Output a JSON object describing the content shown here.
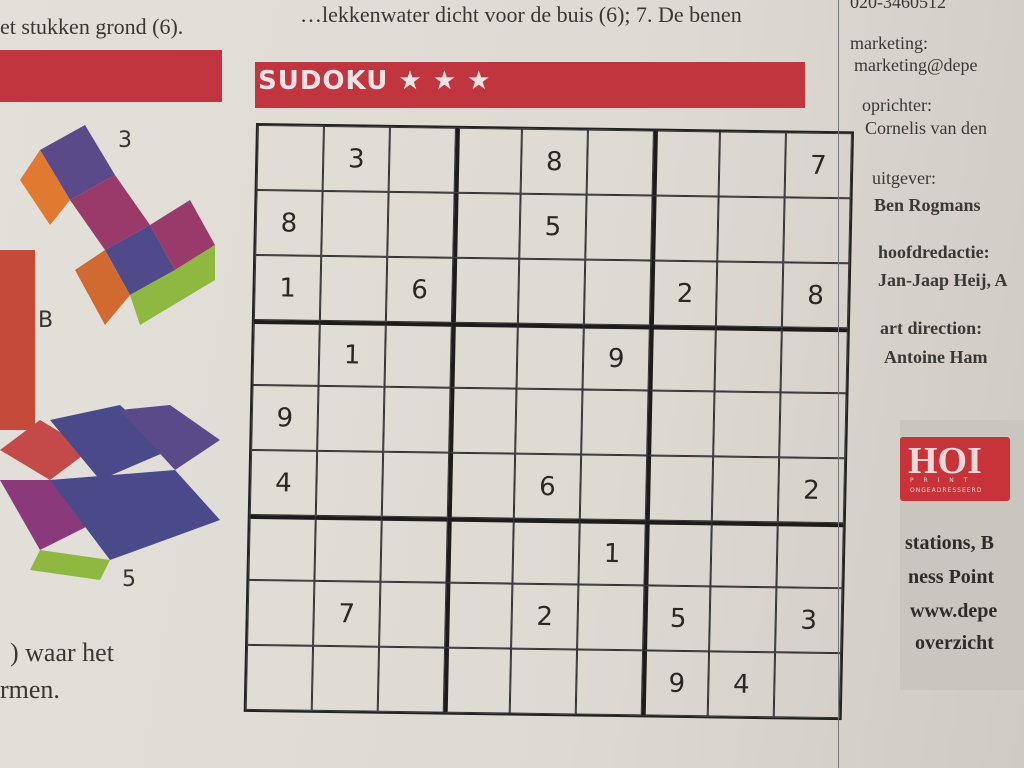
{
  "article": {
    "top_line": "…lekkenwater dicht voor de buis (6); 7. De benen",
    "second_line": "et stukken grond (6).",
    "bottom_line_1": ") waar het",
    "bottom_line_2": "rmen."
  },
  "figure": {
    "labels": [
      "3",
      "B",
      "5"
    ]
  },
  "sudoku": {
    "title": "SUDOKU ★ ★ ★",
    "difficulty_stars": 3,
    "grid": [
      [
        "",
        "3",
        "",
        "",
        "8",
        "",
        "",
        "",
        "7"
      ],
      [
        "8",
        "",
        "",
        "",
        "5",
        "",
        "",
        "",
        ""
      ],
      [
        "1",
        "",
        "6",
        "",
        "",
        "",
        "2",
        "",
        "8"
      ],
      [
        "",
        "1",
        "",
        "",
        "",
        "9",
        "",
        "",
        ""
      ],
      [
        "9",
        "",
        "",
        "",
        "",
        "",
        "",
        "",
        ""
      ],
      [
        "4",
        "",
        "",
        "",
        "6",
        "",
        "",
        "",
        "2"
      ],
      [
        "",
        "",
        "",
        "",
        "",
        "1",
        "",
        "",
        ""
      ],
      [
        "",
        "7",
        "",
        "",
        "2",
        "",
        "5",
        "",
        "3"
      ],
      [
        "",
        "",
        "",
        "",
        "",
        "",
        "9",
        "4",
        ""
      ]
    ]
  },
  "colophon": {
    "phone": "020-3460512",
    "entries": [
      {
        "label": "marketing:",
        "value": "marketing@depe"
      },
      {
        "label": "oprichter:",
        "value": "Cornelis van den"
      },
      {
        "label": "uitgever:",
        "value": "Ben Rogmans"
      },
      {
        "label": "hoofdredactie:",
        "value": "Jan-Jaap Heij, A"
      },
      {
        "label": "art direction:",
        "value": "Antoine Ham"
      }
    ],
    "logo": {
      "main": "HOI",
      "sub1": "P R I N T",
      "sub2": "ONGEADRESSEERD"
    },
    "bottom_lines": [
      "stations, B",
      "ness Point",
      "www.depe",
      "overzicht"
    ]
  },
  "colors": {
    "banner": "#c0353e",
    "paper": "#e0dcd6"
  }
}
